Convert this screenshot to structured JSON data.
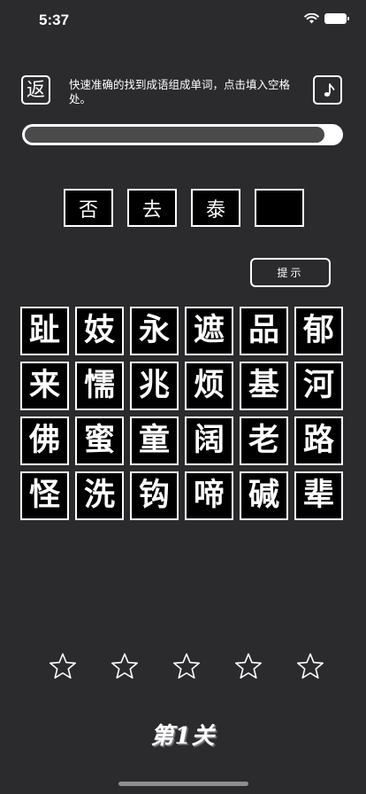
{
  "status_bar": {
    "time": "5:37"
  },
  "header": {
    "back_label": "返",
    "instruction": "快速准确的找到成语组成单词，点击填入空格处。"
  },
  "progress": {
    "fraction": 0.95
  },
  "answer": {
    "slots": [
      "否",
      "去",
      "泰",
      ""
    ]
  },
  "hint_label": "提示",
  "grid": {
    "rows": [
      [
        "趾",
        "妓",
        "永",
        "遮",
        "品",
        "郁"
      ],
      [
        "来",
        "懦",
        "兆",
        "烦",
        "基",
        "河"
      ],
      [
        "佛",
        "蜜",
        "童",
        "阔",
        "老",
        "路"
      ],
      [
        "怪",
        "洗",
        "钩",
        "啼",
        "碱",
        "辈"
      ]
    ]
  },
  "stars": {
    "total": 5,
    "filled": 0
  },
  "level_label": "第1关",
  "colors": {
    "background": "#2b2b2d",
    "tile": "#000000",
    "border": "#ffffff",
    "progress_track": "#ffffff",
    "progress_fill": "#4a4a4a"
  }
}
